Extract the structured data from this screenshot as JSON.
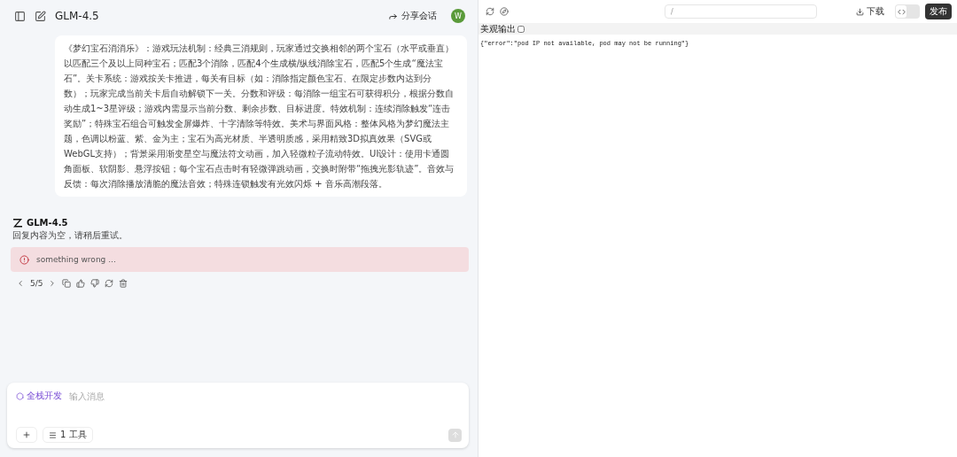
{
  "header": {
    "title": "GLM-4.5",
    "share": "分享会话",
    "avatar": "W"
  },
  "user_message": "《梦幻宝石消消乐》：游戏玩法机制：经典三消规则，玩家通过交换相邻的两个宝石（水平或垂直）以匹配三个及以上同种宝石；匹配3个消除，匹配4个生成横/纵线消除宝石，匹配5个生成“魔法宝石”。关卡系统：游戏按关卡推进，每关有目标（如：消除指定颜色宝石、在限定步数内达到分数）；玩家完成当前关卡后自动解锁下一关。分数和评级：每消除一组宝石可获得积分，根据分数自动生成1~3星评级；游戏内需显示当前分数、剩余步数、目标进度。特效机制：连续消除触发“连击奖励”；特殊宝石组合可触发全屏爆炸、十字清除等特效。美术与界面风格：整体风格为梦幻魔法主题，色调以粉蓝、紫、金为主；宝石为高光材质、半透明质感，采用精致3D拟真效果（SVG或WebGL支持）；背景采用渐变星空与魔法符文动画，加入轻微粒子流动特效。UI设计：使用卡通圆角面板、软阴影、悬浮按钮；每个宝石点击时有轻微弹跳动画，交换时附带“拖拽光影轨迹”。音效与反馈：每次消除播放清脆的魔法音效；特殊连锁触发有光效闪烁 + 音乐高潮段落。",
  "reply": {
    "model": "GLM-4.5",
    "text": "回复内容为空，请稍后重试。",
    "error": "something wrong ...",
    "pager": "5/5"
  },
  "composer": {
    "mode": "全栈开发",
    "placeholder": "输入消息",
    "tools": "1 工具"
  },
  "preview": {
    "path": "/",
    "download": "下载",
    "code_view": {
      "on": false
    },
    "publish": "发布",
    "pretty": {
      "label": "美观输出",
      "checked": false
    },
    "output": "{\"error\":\"pod IP not available, pod may not be running\"}"
  }
}
